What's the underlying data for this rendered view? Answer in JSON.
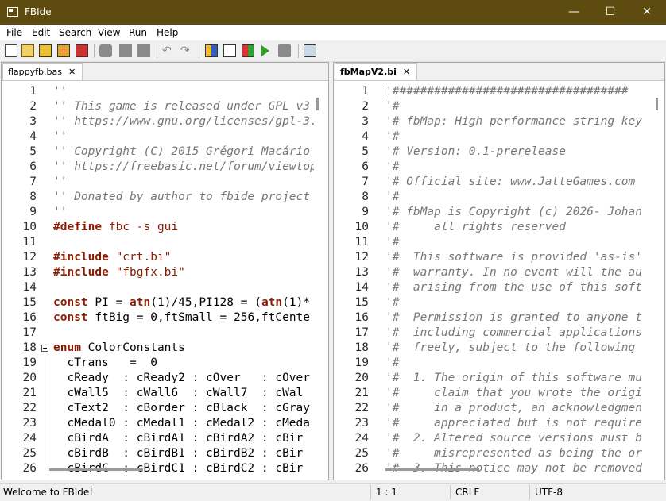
{
  "window": {
    "title": "FBIde",
    "minimize": "—",
    "maximize": "☐",
    "close": "✕"
  },
  "menu": [
    "File",
    "Edit",
    "Search",
    "View",
    "Run",
    "Help"
  ],
  "toolbar_icons": [
    "new-file-icon",
    "open-file-icon",
    "save-icon",
    "save-all-icon",
    "close-file-icon",
    "cut-icon",
    "copy-icon",
    "paste-icon",
    "undo-icon",
    "redo-icon",
    "compile-icon",
    "results-icon",
    "options-icon",
    "run-icon",
    "build-icon",
    "output-icon"
  ],
  "left": {
    "tab": "flappyfb.bas",
    "tab_close": "✕",
    "lines": [
      {
        "n": "1",
        "parts": [
          {
            "t": "''",
            "c": "comment"
          }
        ]
      },
      {
        "n": "2",
        "parts": [
          {
            "t": "'' This game is released under GPL v3",
            "c": "comment"
          }
        ]
      },
      {
        "n": "3",
        "parts": [
          {
            "t": "'' https://www.gnu.org/licenses/gpl-3.",
            "c": "comment"
          }
        ]
      },
      {
        "n": "4",
        "parts": [
          {
            "t": "''",
            "c": "comment"
          }
        ]
      },
      {
        "n": "5",
        "parts": [
          {
            "t": "'' Copyright (C) 2015 Grégori Macário",
            "c": "comment"
          }
        ]
      },
      {
        "n": "6",
        "parts": [
          {
            "t": "'' https://freebasic.net/forum/viewtop",
            "c": "comment"
          }
        ]
      },
      {
        "n": "7",
        "parts": [
          {
            "t": "''",
            "c": "comment"
          }
        ]
      },
      {
        "n": "8",
        "parts": [
          {
            "t": "'' Donated by author to fbide project",
            "c": "comment"
          }
        ]
      },
      {
        "n": "9",
        "parts": [
          {
            "t": "''",
            "c": "comment"
          }
        ]
      },
      {
        "n": "10",
        "parts": [
          {
            "t": "#define",
            "c": "kw"
          },
          {
            "t": " fbc -s gui",
            "c": "str"
          }
        ]
      },
      {
        "n": "11",
        "parts": []
      },
      {
        "n": "12",
        "parts": [
          {
            "t": "#include",
            "c": "kw"
          },
          {
            "t": " \"crt.bi\"",
            "c": "str"
          }
        ]
      },
      {
        "n": "13",
        "parts": [
          {
            "t": "#include",
            "c": "kw"
          },
          {
            "t": " \"fbgfx.bi\"",
            "c": "str"
          }
        ]
      },
      {
        "n": "14",
        "parts": []
      },
      {
        "n": "15",
        "parts": [
          {
            "t": "const",
            "c": "kw"
          },
          {
            "t": " PI = ",
            "c": ""
          },
          {
            "t": "atn",
            "c": "fn"
          },
          {
            "t": "(1)/45,PI128 = (",
            "c": ""
          },
          {
            "t": "atn",
            "c": "fn"
          },
          {
            "t": "(1)*",
            "c": ""
          }
        ]
      },
      {
        "n": "16",
        "parts": [
          {
            "t": "const",
            "c": "kw"
          },
          {
            "t": " ftBig = 0,ftSmall = 256,ftCente",
            "c": ""
          }
        ]
      },
      {
        "n": "17",
        "parts": []
      },
      {
        "n": "18",
        "parts": [
          {
            "t": "enum",
            "c": "kw"
          },
          {
            "t": " ColorConstants",
            "c": ""
          }
        ]
      },
      {
        "n": "19",
        "parts": [
          {
            "t": "  cTrans   =  0",
            "c": ""
          }
        ]
      },
      {
        "n": "20",
        "parts": [
          {
            "t": "  cReady  : cReady2 : cOver   : cOver",
            "c": ""
          }
        ]
      },
      {
        "n": "21",
        "parts": [
          {
            "t": "  cWall5  : cWall6  : cWall7  : cWal",
            "c": ""
          }
        ]
      },
      {
        "n": "22",
        "parts": [
          {
            "t": "  cText2  : cBorder : cBlack  : cGray",
            "c": ""
          }
        ]
      },
      {
        "n": "23",
        "parts": [
          {
            "t": "  cMedal0 : cMedal1 : cMedal2 : cMeda",
            "c": ""
          }
        ]
      },
      {
        "n": "24",
        "parts": [
          {
            "t": "  cBirdA  : cBirdA1 : cBirdA2 : cBir",
            "c": ""
          }
        ]
      },
      {
        "n": "25",
        "parts": [
          {
            "t": "  cBirdB  : cBirdB1 : cBirdB2 : cBir",
            "c": ""
          }
        ]
      },
      {
        "n": "26",
        "parts": [
          {
            "t": "  cBirdC  : cBirdC1 : cBirdC2 : cBir",
            "c": ""
          }
        ]
      }
    ]
  },
  "right": {
    "tab": "fbMapV2.bi",
    "tab_close": "✕",
    "lines": [
      {
        "n": "1",
        "parts": [
          {
            "t": "'##################################",
            "c": "comment"
          }
        ]
      },
      {
        "n": "2",
        "parts": [
          {
            "t": "'#",
            "c": "comment"
          }
        ]
      },
      {
        "n": "3",
        "parts": [
          {
            "t": "'# fbMap: High performance string key",
            "c": "comment"
          }
        ]
      },
      {
        "n": "4",
        "parts": [
          {
            "t": "'#",
            "c": "comment"
          }
        ]
      },
      {
        "n": "5",
        "parts": [
          {
            "t": "'# Version: 0.1-prerelease",
            "c": "comment"
          }
        ]
      },
      {
        "n": "6",
        "parts": [
          {
            "t": "'#",
            "c": "comment"
          }
        ]
      },
      {
        "n": "7",
        "parts": [
          {
            "t": "'# Official site: www.JatteGames.com",
            "c": "comment"
          }
        ]
      },
      {
        "n": "8",
        "parts": [
          {
            "t": "'#",
            "c": "comment"
          }
        ]
      },
      {
        "n": "9",
        "parts": [
          {
            "t": "'# fbMap is Copyright (c) 2026- Johan",
            "c": "comment"
          }
        ]
      },
      {
        "n": "10",
        "parts": [
          {
            "t": "'#     all rights reserved",
            "c": "comment"
          }
        ]
      },
      {
        "n": "11",
        "parts": [
          {
            "t": "'#",
            "c": "comment"
          }
        ]
      },
      {
        "n": "12",
        "parts": [
          {
            "t": "'#  This software is provided 'as-is'",
            "c": "comment"
          }
        ]
      },
      {
        "n": "13",
        "parts": [
          {
            "t": "'#  warranty. In no event will the au",
            "c": "comment"
          }
        ]
      },
      {
        "n": "14",
        "parts": [
          {
            "t": "'#  arising from the use of this soft",
            "c": "comment"
          }
        ]
      },
      {
        "n": "15",
        "parts": [
          {
            "t": "'#",
            "c": "comment"
          }
        ]
      },
      {
        "n": "16",
        "parts": [
          {
            "t": "'#  Permission is granted to anyone t",
            "c": "comment"
          }
        ]
      },
      {
        "n": "17",
        "parts": [
          {
            "t": "'#  including commercial applications",
            "c": "comment"
          }
        ]
      },
      {
        "n": "18",
        "parts": [
          {
            "t": "'#  freely, subject to the following",
            "c": "comment"
          }
        ]
      },
      {
        "n": "19",
        "parts": [
          {
            "t": "'#",
            "c": "comment"
          }
        ]
      },
      {
        "n": "20",
        "parts": [
          {
            "t": "'#  1. The origin of this software mu",
            "c": "comment"
          }
        ]
      },
      {
        "n": "21",
        "parts": [
          {
            "t": "'#     claim that you wrote the origi",
            "c": "comment"
          }
        ]
      },
      {
        "n": "22",
        "parts": [
          {
            "t": "'#     in a product, an acknowledgmen",
            "c": "comment"
          }
        ]
      },
      {
        "n": "23",
        "parts": [
          {
            "t": "'#     appreciated but is not require",
            "c": "comment"
          }
        ]
      },
      {
        "n": "24",
        "parts": [
          {
            "t": "'#  2. Altered source versions must b",
            "c": "comment"
          }
        ]
      },
      {
        "n": "25",
        "parts": [
          {
            "t": "'#     misrepresented as being the or",
            "c": "comment"
          }
        ]
      },
      {
        "n": "26",
        "parts": [
          {
            "t": "'#  3. This notice may not be removed",
            "c": "comment"
          }
        ]
      }
    ]
  },
  "status": {
    "message": "Welcome to FBIde!",
    "position": "1 : 1",
    "eol": "CRLF",
    "encoding": "UTF-8"
  }
}
